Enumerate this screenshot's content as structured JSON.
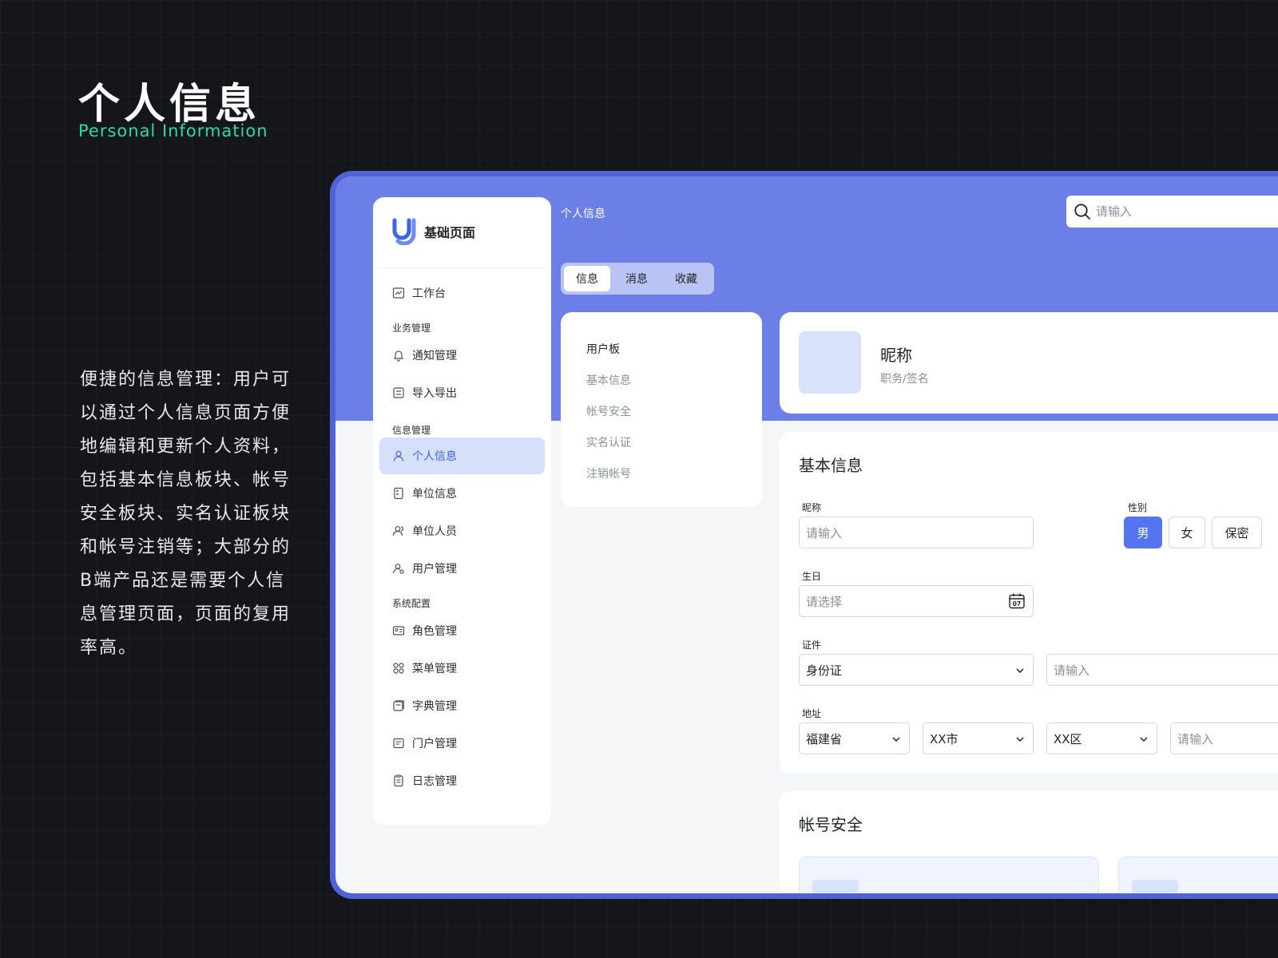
{
  "hero": {
    "title": "个人信息",
    "subtitle": "Personal Information",
    "description": "便捷的信息管理：用户可以通过个人信息页面方便地编辑和更新个人资料，包括基本信息板块、帐号安全板块、实名认证板块和帐号注销等；大部分的B端产品还是需要个人信息管理页面，页面的复用率高。"
  },
  "brand": {
    "name": "基础页面",
    "logo_icon": "uj-logo-icon",
    "accent_color": "#3e63e6"
  },
  "sidebar": {
    "items": [
      {
        "label": "工作台",
        "icon": "chart-icon"
      },
      {
        "group": "业务管理"
      },
      {
        "label": "通知管理",
        "icon": "bell-icon"
      },
      {
        "label": "导入导出",
        "icon": "import-export-icon"
      },
      {
        "group": "信息管理"
      },
      {
        "label": "个人信息",
        "icon": "user-icon",
        "active": true
      },
      {
        "label": "单位信息",
        "icon": "building-icon"
      },
      {
        "label": "单位人员",
        "icon": "users-icon"
      },
      {
        "label": "用户管理",
        "icon": "user-manage-icon"
      },
      {
        "group": "系统配置"
      },
      {
        "label": "角色管理",
        "icon": "id-card-icon"
      },
      {
        "label": "菜单管理",
        "icon": "grid-icon"
      },
      {
        "label": "字典管理",
        "icon": "book-icon"
      },
      {
        "label": "门户管理",
        "icon": "portal-icon"
      },
      {
        "label": "日志管理",
        "icon": "log-icon"
      }
    ]
  },
  "header": {
    "breadcrumb": "个人信息",
    "search_placeholder": "请输入",
    "search_icon": "search-icon",
    "header_color": "#6b7fe6"
  },
  "tabs": [
    {
      "label": "信息",
      "active": true
    },
    {
      "label": "消息"
    },
    {
      "label": "收藏"
    }
  ],
  "user_panel": {
    "title": "用户板",
    "items": [
      "基本信息",
      "帐号安全",
      "实名认证",
      "注销帐号"
    ]
  },
  "profile": {
    "nickname": "昵称",
    "signature": "职务/签名"
  },
  "basic_info": {
    "title": "基本信息",
    "nickname_label": "昵称",
    "nickname_placeholder": "请输入",
    "gender_label": "性别",
    "gender_options": [
      "男",
      "女",
      "保密"
    ],
    "gender_selected": "男",
    "birthday_label": "生日",
    "birthday_placeholder": "请选择",
    "calendar_day": "07",
    "id_label": "证件",
    "id_type": "身份证",
    "id_number_placeholder": "请输入",
    "address_label": "地址",
    "province": "福建省",
    "city": "XX市",
    "district": "XX区",
    "address_placeholder": "请输入"
  },
  "security": {
    "title": "帐号安全"
  }
}
